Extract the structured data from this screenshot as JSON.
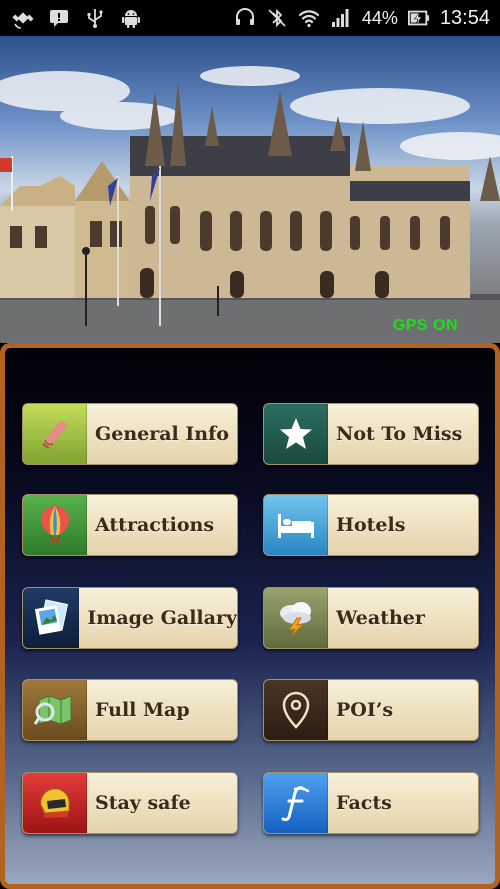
{
  "status_bar": {
    "battery": "44%",
    "time": "13:54"
  },
  "hero": {
    "gps_status": "GPS ON"
  },
  "menu": {
    "general_info": "General Info",
    "not_to_miss": "Not To Miss",
    "attractions": "Attractions",
    "hotels": "Hotels",
    "image_gallary": "Image Gallary",
    "weather": "Weather",
    "full_map": "Full Map",
    "pois": "POI’s",
    "stay_safe": "Stay safe",
    "facts": "Facts"
  },
  "colors": {
    "panel_border": "#b2631f",
    "gps_text": "#19e01b"
  }
}
